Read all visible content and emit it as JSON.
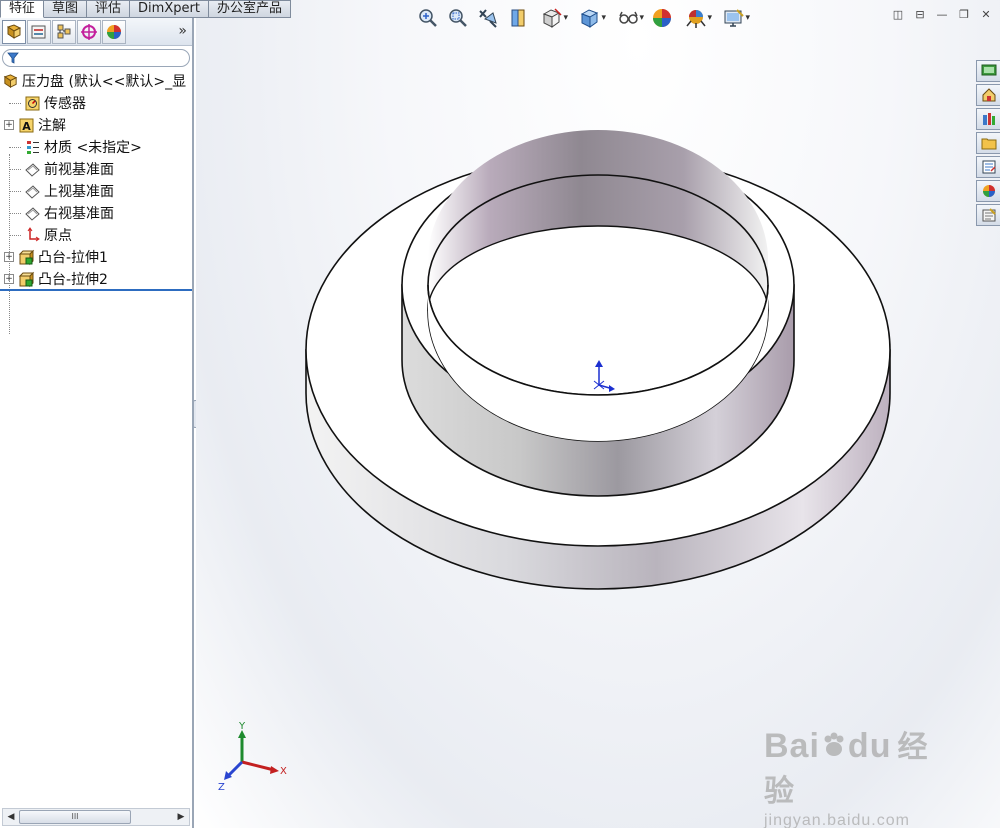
{
  "command_tabs": [
    {
      "label": "特征",
      "active": true
    },
    {
      "label": "草图",
      "active": false
    },
    {
      "label": "评估",
      "active": false
    },
    {
      "label": "DimXpert",
      "active": false
    },
    {
      "label": "办公室产品",
      "active": false
    }
  ],
  "panel": {
    "more_label": "»",
    "tabs": [
      "feature-manager-icon",
      "property-manager-icon",
      "configuration-manager-icon",
      "dimxpert-manager-icon",
      "display-manager-icon"
    ]
  },
  "tree": {
    "root_label": "压力盘 (默认<<默认>_显",
    "items": [
      {
        "label": "传感器",
        "icon": "sensor-icon",
        "expandable": false
      },
      {
        "label": "注解",
        "icon": "annotation-icon",
        "expandable": true
      },
      {
        "label": "材质 <未指定>",
        "icon": "material-icon",
        "expandable": false
      },
      {
        "label": "前视基准面",
        "icon": "plane-icon",
        "expandable": false
      },
      {
        "label": "上视基准面",
        "icon": "plane-icon",
        "expandable": false
      },
      {
        "label": "右视基准面",
        "icon": "plane-icon",
        "expandable": false
      },
      {
        "label": "原点",
        "icon": "origin-icon",
        "expandable": false
      },
      {
        "label": "凸台-拉伸1",
        "icon": "boss-extrude-icon",
        "expandable": true
      },
      {
        "label": "凸台-拉伸2",
        "icon": "boss-extrude-icon",
        "expandable": true
      }
    ]
  },
  "scrollbar": {
    "thumb_label": "III"
  },
  "view_toolbar": [
    "zoom-to-fit-icon",
    "zoom-to-area-icon",
    "previous-view-icon",
    "section-view-icon",
    "view-orientation-icon",
    "display-style-icon",
    "hide-show-items-icon",
    "edit-appearance-icon",
    "apply-scene-icon",
    "view-settings-icon"
  ],
  "triad": {
    "y_label": "Y",
    "x_label": "X",
    "z_label": "Z"
  },
  "watermark": {
    "brand": "Bai",
    "brand2": "du",
    "cn": "经验",
    "url": "jingyan.baidu.com"
  },
  "colors": {
    "accent": "#2d6cc0",
    "model_face": "#ffffff",
    "model_inner": "#b7aab9"
  }
}
